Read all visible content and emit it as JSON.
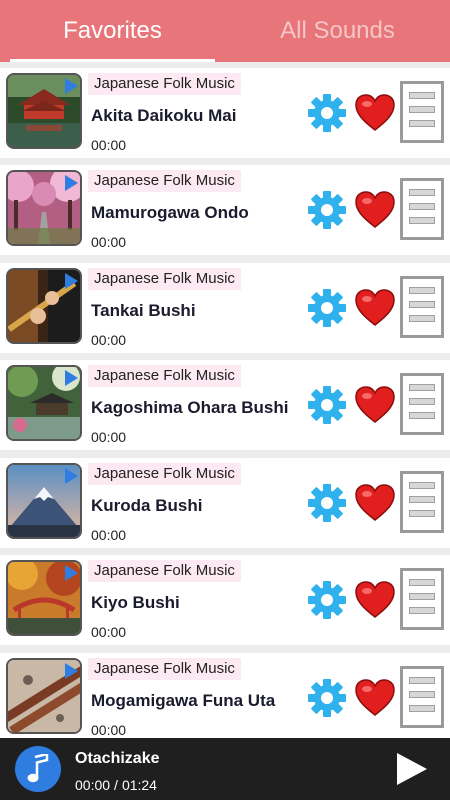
{
  "tabs": [
    {
      "label": "Favorites",
      "active": true
    },
    {
      "label": "All Sounds",
      "active": false
    }
  ],
  "colors": {
    "accent": "#e8757a",
    "play_badge": "#2f7de1",
    "gear": "#2eb1ec",
    "heart": "#e21f1f"
  },
  "songs": [
    {
      "genre": "Japanese Folk Music",
      "title": "Akita Daikoku Mai",
      "time": "00:00",
      "thumb_icon": "red-temple-pond-image"
    },
    {
      "genre": "Japanese Folk Music",
      "title": "Mamurogawa Ondo",
      "time": "00:00",
      "thumb_icon": "cherry-blossom-path-image"
    },
    {
      "genre": "Japanese Folk Music",
      "title": "Tankai Bushi",
      "time": "00:00",
      "thumb_icon": "flute-player-image"
    },
    {
      "genre": "Japanese Folk Music",
      "title": "Kagoshima Ohara Bushi",
      "time": "00:00",
      "thumb_icon": "garden-pavilion-image"
    },
    {
      "genre": "Japanese Folk Music",
      "title": "Kuroda Bushi",
      "time": "00:00",
      "thumb_icon": "mount-fuji-image"
    },
    {
      "genre": "Japanese Folk Music",
      "title": "Kiyo Bushi",
      "time": "00:00",
      "thumb_icon": "autumn-bridge-image"
    },
    {
      "genre": "Japanese Folk Music",
      "title": "Mogamigawa Funa Uta",
      "time": "00:00",
      "thumb_icon": "bamboo-flute-image"
    }
  ],
  "player": {
    "title": "Otachizake",
    "current_time": "00:00",
    "separator": "/",
    "duration": "01:24"
  }
}
